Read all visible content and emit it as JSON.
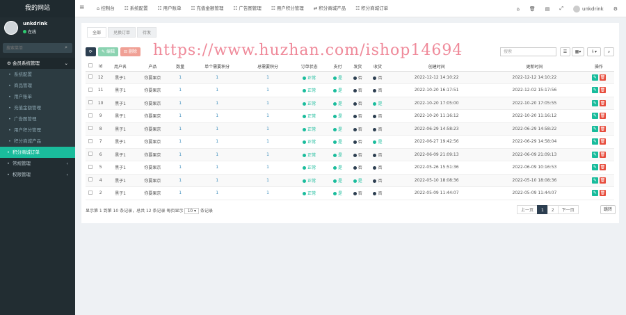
{
  "sidebar": {
    "logo": "我的网站",
    "user": {
      "name": "unkdrink",
      "status": "在线"
    },
    "search_placeholder": "搜索菜单",
    "items": [
      {
        "label": "会员系统管理",
        "icon": "gear-icon",
        "type": "group",
        "chevron": "⌄"
      },
      {
        "label": "系统配置",
        "type": "sub"
      },
      {
        "label": "商品管理",
        "type": "sub"
      },
      {
        "label": "用户账单",
        "type": "sub"
      },
      {
        "label": "充值金额管理",
        "type": "sub"
      },
      {
        "label": "广告图管理",
        "type": "sub"
      },
      {
        "label": "用户积分管理",
        "type": "sub"
      },
      {
        "label": "积分商城产品",
        "type": "sub"
      },
      {
        "label": "积分商城订单",
        "type": "active"
      },
      {
        "label": "常规管理",
        "type": "item",
        "chevron": "‹"
      },
      {
        "label": "权限管理",
        "type": "item",
        "chevron": "‹"
      }
    ]
  },
  "topbar": {
    "tabs": [
      "⌂ 控制台",
      "☷ 系统配置",
      "☷ 用户账单",
      "☷ 充值金额管理",
      "☷ 广告图管理",
      "☷ 用户积分管理",
      "⇄ 积分商城产品",
      "☷ 积分商城订单"
    ],
    "username": "unkdrink"
  },
  "subtabs": [
    "全部",
    "兑换订单",
    "待发"
  ],
  "toolbar": {
    "refresh": "⟳",
    "edit": "✎ 编辑",
    "delete": "⊟ 删除",
    "search_placeholder": "搜索"
  },
  "watermark": "https://www.huzhan.com/ishop14694",
  "table": {
    "headers": [
      "",
      "Id",
      "用户名",
      "产品",
      "数量",
      "单个需要积分",
      "总需要积分",
      "订单状态",
      "支付",
      "发货",
      "收货",
      "创建时间",
      "更新时间",
      "操作"
    ],
    "rows": [
      [
        "12",
        "黑子1",
        "你要果京",
        "1",
        "1",
        "1",
        "正常",
        "是",
        "否",
        "否",
        "2022-12-12 14:10:22",
        "2022-12-12 14:10:22"
      ],
      [
        "11",
        "黑子1",
        "你要果京",
        "1",
        "1",
        "1",
        "正常",
        "是",
        "否",
        "否",
        "2022-10-20 16:17:51",
        "2022-12-02 15:17:56"
      ],
      [
        "10",
        "黑子1",
        "你要果京",
        "1",
        "1",
        "1",
        "正常",
        "是",
        "否",
        "是",
        "2022-10-20 17:05:00",
        "2022-10-20 17:05:55"
      ],
      [
        "9",
        "黑子1",
        "你要果京",
        "1",
        "1",
        "1",
        "正常",
        "是",
        "否",
        "否",
        "2022-10-20 11:16:12",
        "2022-10-20 11:16:12"
      ],
      [
        "8",
        "黑子1",
        "你要果京",
        "1",
        "1",
        "1",
        "正常",
        "是",
        "否",
        "否",
        "2022-06-29 14:58:23",
        "2022-06-29 14:58:22"
      ],
      [
        "7",
        "黑子1",
        "你要果京",
        "1",
        "1",
        "1",
        "正常",
        "是",
        "否",
        "是",
        "2022-06-27 19:42:56",
        "2022-06-29 14:58:04"
      ],
      [
        "6",
        "黑子1",
        "你要果京",
        "1",
        "1",
        "1",
        "正常",
        "是",
        "否",
        "否",
        "2022-06-09 21:09:13",
        "2022-06-09 21:09:13"
      ],
      [
        "5",
        "黑子1",
        "你要果京",
        "1",
        "1",
        "1",
        "正常",
        "是",
        "否",
        "否",
        "2022-05-26 15:51:36",
        "2022-06-09 10:16:53"
      ],
      [
        "4",
        "黑子1",
        "你要果京",
        "1",
        "1",
        "1",
        "正常",
        "是",
        "是",
        "否",
        "2022-05-10 18:08:36",
        "2022-05-10 18:08:36"
      ],
      [
        "2",
        "黑子1",
        "你要果京",
        "1",
        "1",
        "1",
        "正常",
        "是",
        "否",
        "否",
        "2022-05-09 11:44:07",
        "2022-05-09 11:44:07"
      ]
    ]
  },
  "pagination": {
    "info_before": "显示第 1 到第 10 条记录，总共 12 条记录 每页显示",
    "page_size": "10 ▾",
    "info_after": "条记录",
    "pages": [
      "上一页",
      "1",
      "2",
      "下一页"
    ],
    "jump": "跳转"
  }
}
